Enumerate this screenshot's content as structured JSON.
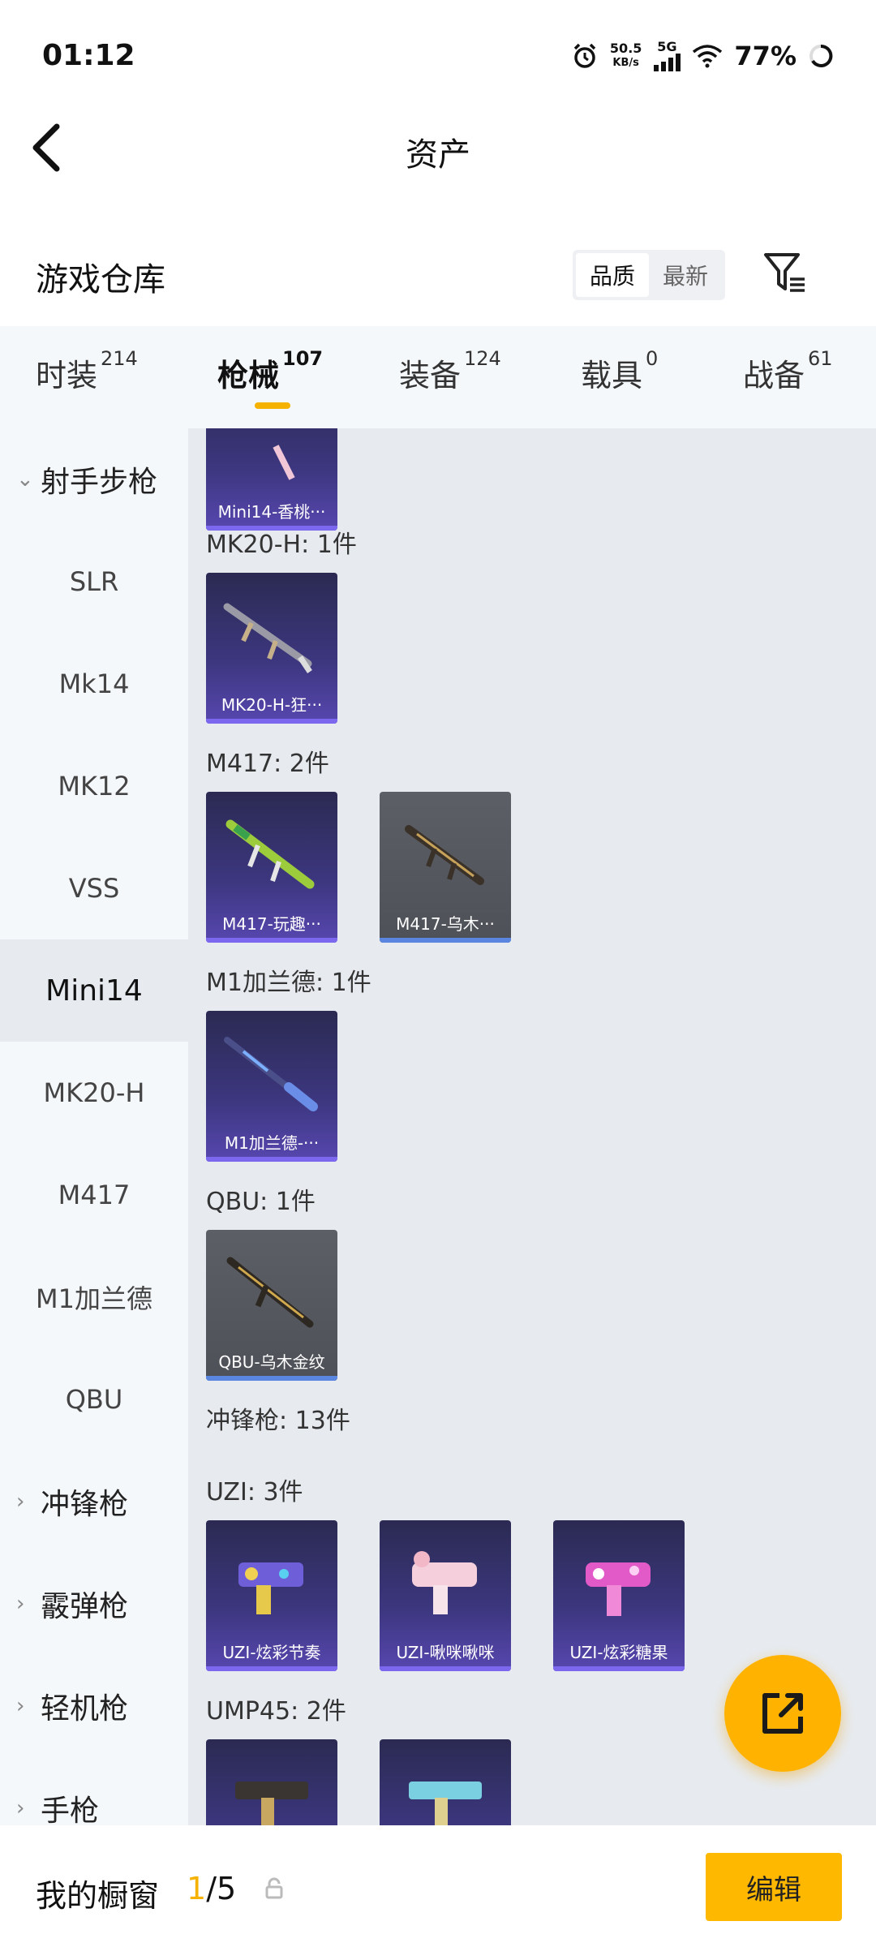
{
  "status": {
    "time": "01:12",
    "net_speed_value": "50.5",
    "net_speed_unit": "KB/s",
    "network": "5G",
    "battery": "77%"
  },
  "header": {
    "title": "资产"
  },
  "warehouse": {
    "title": "游戏仓库",
    "sort_options": [
      "品质",
      "最新"
    ],
    "sort_selected": "品质"
  },
  "tabs": [
    {
      "label": "时装",
      "count": "214"
    },
    {
      "label": "枪械",
      "count": "107"
    },
    {
      "label": "装备",
      "count": "124"
    },
    {
      "label": "载具",
      "count": "0"
    },
    {
      "label": "战备",
      "count": "61"
    }
  ],
  "active_tab": "枪械",
  "sidebar": {
    "items": [
      {
        "label": "射手步枪",
        "type": "category",
        "expanded": true
      },
      {
        "label": "SLR"
      },
      {
        "label": "Mk14"
      },
      {
        "label": "MK12"
      },
      {
        "label": "VSS"
      },
      {
        "label": "Mini14",
        "active": true
      },
      {
        "label": "MK20-H"
      },
      {
        "label": "M417"
      },
      {
        "label": "M1加兰德"
      },
      {
        "label": "QBU"
      },
      {
        "label": "冲锋枪",
        "type": "category"
      },
      {
        "label": "霰弹枪",
        "type": "category"
      },
      {
        "label": "轻机枪",
        "type": "category"
      },
      {
        "label": "手枪",
        "type": "category"
      }
    ]
  },
  "content": {
    "top_card": "Mini14-香桃···",
    "groups": [
      {
        "label": "MK20-H: 1件",
        "cards": [
          {
            "name": "MK20-H-狂···",
            "tier": "purple"
          }
        ]
      },
      {
        "label": "M417: 2件",
        "cards": [
          {
            "name": "M417-玩趣···",
            "tier": "purple"
          },
          {
            "name": "M417-乌木···",
            "tier": "gray"
          }
        ]
      },
      {
        "label": "M1加兰德: 1件",
        "cards": [
          {
            "name": "M1加兰德-···",
            "tier": "purple"
          }
        ]
      },
      {
        "label": "QBU: 1件",
        "cards": [
          {
            "name": "QBU-乌木金纹",
            "tier": "gray"
          }
        ]
      },
      {
        "label": "冲锋枪: 13件",
        "cards": []
      },
      {
        "label": "UZI: 3件",
        "cards": [
          {
            "name": "UZI-炫彩节奏",
            "tier": "purple"
          },
          {
            "name": "UZI-啾咪啾咪",
            "tier": "purple"
          },
          {
            "name": "UZI-炫彩糖果",
            "tier": "purple"
          }
        ]
      },
      {
        "label": "UMP45: 2件",
        "cards": [
          {
            "name": "",
            "tier": "purple"
          },
          {
            "name": "",
            "tier": "purple"
          }
        ]
      }
    ]
  },
  "bottom": {
    "showcase_label": "我的橱窗",
    "showcase_current": "1",
    "showcase_total": "/5",
    "edit_label": "编辑"
  },
  "colors": {
    "accent": "#ffb800",
    "purple_card": "#3d3780",
    "gray_card": "#555860"
  },
  "icons": [
    "back-arrow-icon",
    "filter-icon",
    "share-export-icon",
    "lock-icon",
    "chevron-down-icon",
    "chevron-right-icon",
    "alarm-icon",
    "signal-icon",
    "wifi-icon",
    "battery-icon"
  ]
}
